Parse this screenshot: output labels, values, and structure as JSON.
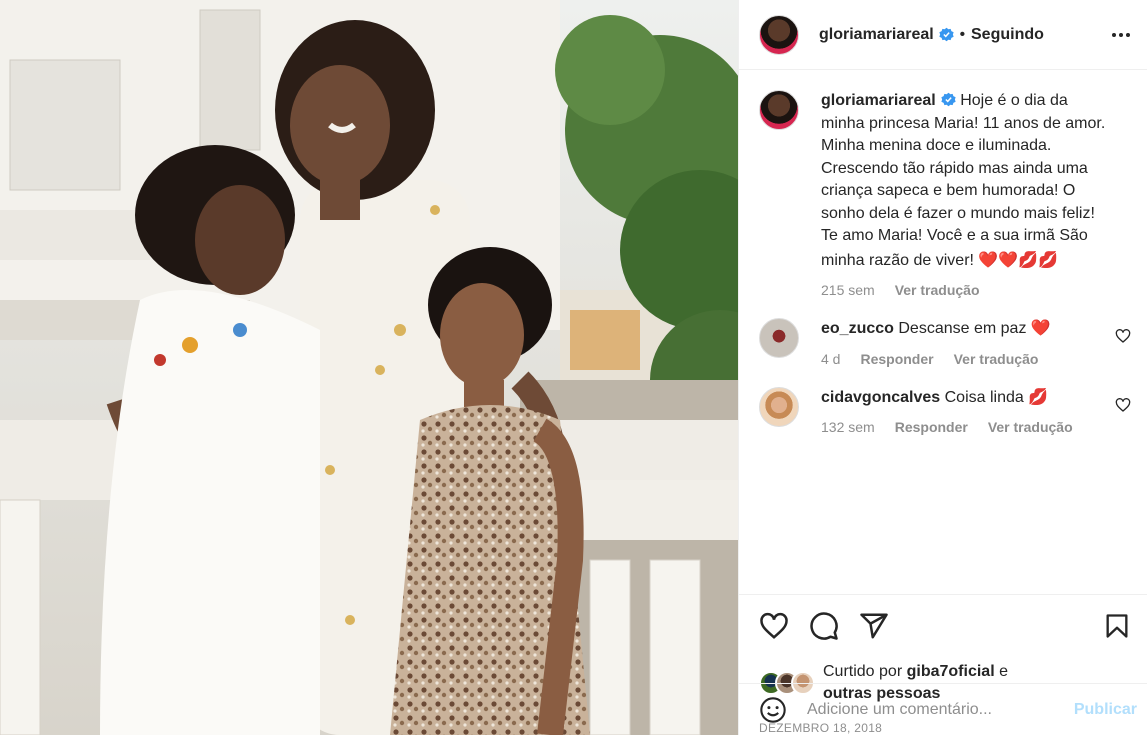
{
  "post": {
    "username": "gloriamariareal",
    "separator": "•",
    "follow_status": "Seguindo",
    "caption": "Hoje é o dia da minha princesa Maria! 11 anos de amor. Minha menina doce e iluminada. Crescendo tão rápido mas ainda uma criança sapeca e bem humorada! O sonho dela é fazer o mundo mais feliz! Te amo Maria! Você e a sua irmã São minha razão de viver!",
    "caption_emojis": "❤️❤️💋💋",
    "caption_time": "215 sem",
    "translate_label": "Ver tradução"
  },
  "comments": [
    {
      "username": "eo_zucco",
      "text": "Descanse em paz",
      "emoji": "❤️",
      "time": "4 d",
      "reply_label": "Responder",
      "translate_label": "Ver tradução"
    },
    {
      "username": "cidavgoncalves",
      "text": "Coisa linda",
      "emoji": "💋",
      "time": "132 sem",
      "reply_label": "Responder",
      "translate_label": "Ver tradução"
    }
  ],
  "likes": {
    "prefix": "Curtido por",
    "user": "giba7oficial",
    "conjunction": "e",
    "others": "outras pessoas"
  },
  "date": "DEZEMBRO 18, 2018",
  "add_comment": {
    "placeholder": "Adicione um comentário...",
    "post_label": "Publicar"
  },
  "icons": {
    "like": "heart-outline-icon",
    "comment": "speech-bubble-icon",
    "share": "paper-plane-icon",
    "save": "bookmark-icon",
    "more": "three-dots-icon",
    "emoji": "smiley-icon",
    "verified": "verified-badge-icon"
  },
  "colors": {
    "verified": "#3897f0",
    "text": "#262626",
    "muted": "#8e8e8e",
    "publish_disabled": "#b2dffc",
    "heart": "#ed4956"
  }
}
